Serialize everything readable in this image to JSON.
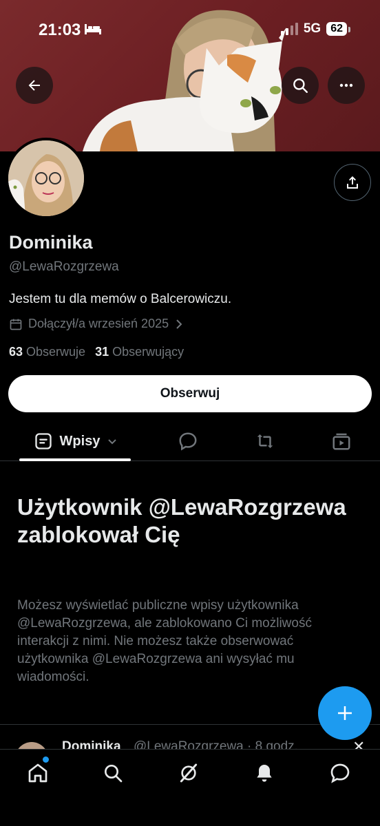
{
  "status_bar": {
    "time": "21:03",
    "network": "5G",
    "battery": "62"
  },
  "profile": {
    "name": "Dominika",
    "handle": "@LewaRozgrzewa",
    "bio": "Jestem tu dla memów o Balcerowiczu.",
    "joined": "Dołączył/a wrzesień 2025",
    "following_count": "63",
    "following_label": "Obserwuje",
    "followers_count": "31",
    "followers_label": "Obserwujący",
    "follow_button": "Obserwuj"
  },
  "tabs": {
    "posts_label": "Wpisy"
  },
  "blocked": {
    "title": "Użytkownik @LewaRozgrzewa zablokował Cię",
    "description": "Możesz wyświetlać publiczne wpisy użytkownika @LewaRozgrzewa, ale zablokowano Ci możliwość interakcji z nimi. Nie możesz także obserwować użytkownika @LewaRozgrzewa ani wysyłać mu wiadomości."
  },
  "post_preview": {
    "author": "Dominika",
    "meta": "@LewaRozgrzewa · 8 godz."
  },
  "colors": {
    "accent": "#1d9bf0",
    "banner": "#6c1f23",
    "muted_text": "#71767b"
  },
  "icons": {
    "back": "arrow-left-icon",
    "search": "search-icon",
    "more": "more-icon",
    "share": "share-icon",
    "calendar": "calendar-icon",
    "compose": "plus-icon"
  }
}
